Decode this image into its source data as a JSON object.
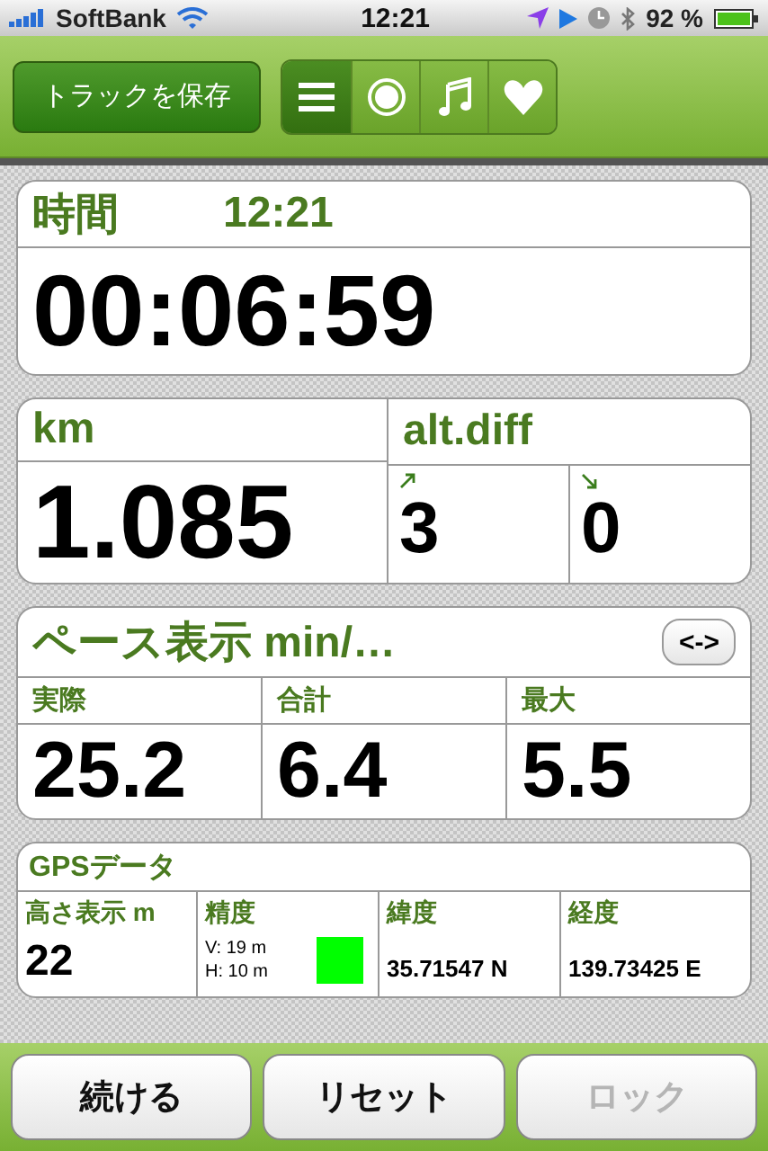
{
  "status_bar": {
    "carrier": "SoftBank",
    "time": "12:21",
    "battery": "92 %"
  },
  "toolbar": {
    "save_button": "トラックを保存",
    "segments": [
      {
        "kind": "list",
        "selected": true
      },
      {
        "kind": "record",
        "selected": false
      },
      {
        "kind": "music",
        "selected": false
      },
      {
        "kind": "heart",
        "selected": false
      }
    ]
  },
  "time_card": {
    "label": "時間",
    "clock": "12:21",
    "value": "00:06:59"
  },
  "distance_card": {
    "label": "km",
    "value": "1.085",
    "alt_label": "alt.diff",
    "alt_up": "3",
    "alt_down": "0"
  },
  "pace_card": {
    "title": "ペース表示 min/…",
    "toggle": "<->",
    "columns": [
      {
        "label": "実際",
        "value": "25.2"
      },
      {
        "label": "合計",
        "value": "6.4"
      },
      {
        "label": "最大",
        "value": "5.5"
      }
    ]
  },
  "gps_card": {
    "title": "GPSデータ",
    "altitude": {
      "label": "高さ表示 m",
      "value": "22"
    },
    "accuracy": {
      "label": "精度",
      "vertical": "V: 19 m",
      "horizontal": "H: 10 m",
      "color": "#00ff00"
    },
    "latitude": {
      "label": "緯度",
      "value": "35.71547 N"
    },
    "longitude": {
      "label": "経度",
      "value": "139.73425 E"
    }
  },
  "bottom_buttons": [
    {
      "label": "続ける",
      "disabled": false
    },
    {
      "label": "リセット",
      "disabled": false
    },
    {
      "label": "ロック",
      "disabled": true
    }
  ]
}
